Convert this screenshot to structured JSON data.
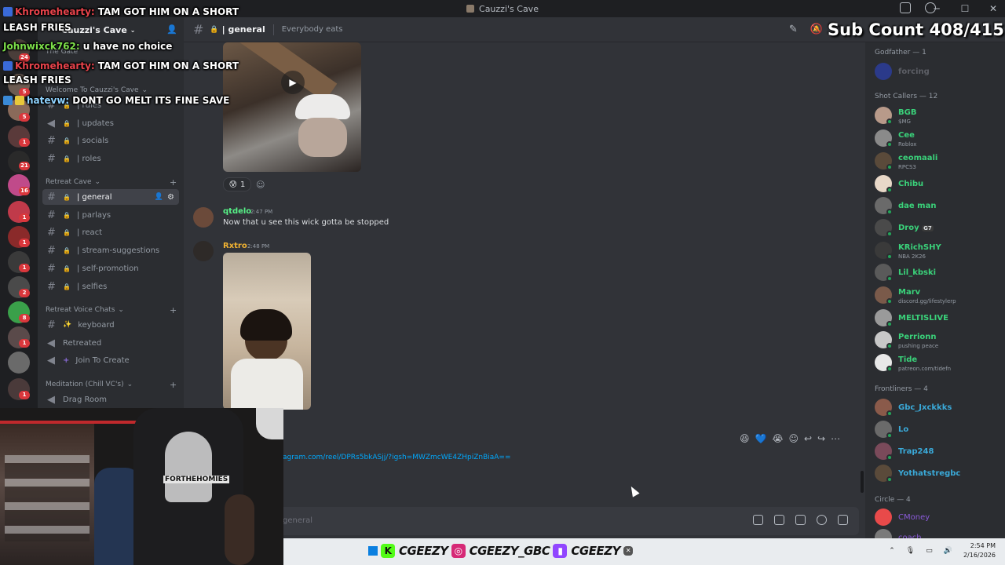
{
  "window": {
    "title": "Cauzzi's Cave"
  },
  "server": {
    "name": "Cauzzi's Cave"
  },
  "sidebar": {
    "categories": {
      "the_gate": "The Gate",
      "welcome": "Welcome To Cauzzi's Cave",
      "retreat_cave": "Retreat Cave",
      "retreat_voice": "Retreat Voice Chats",
      "meditation": "Meditation (Chill VC's)"
    },
    "welcome_channels": [
      "| rules",
      "| updates",
      "| socials",
      "| roles"
    ],
    "retreat_channels": [
      "| general",
      "| parlays",
      "| react",
      "| stream-suggestions",
      "| self-promotion",
      "| selfies"
    ],
    "voice_channels": [
      "keyboard",
      "Retreated",
      "Join To Create"
    ],
    "meditation_channels": [
      "Drag Room"
    ],
    "rail_badges": [
      "24",
      "5",
      "5",
      "1",
      "21",
      "16",
      "1",
      "1",
      "1",
      "2",
      "8",
      "1",
      "1"
    ]
  },
  "channel_header": {
    "name": "| general",
    "topic": "Everybody eats"
  },
  "messages": [
    {
      "reaction_count": "1"
    },
    {
      "author": "qtdelo",
      "time": "2:47 PM",
      "text": "Now that u see this wick gotta be stopped",
      "color": "#57f287"
    },
    {
      "author": "Rxtro",
      "time": "2:48 PM",
      "color": "#f0b232"
    }
  ],
  "composer": {
    "link": "agram.com/reel/DPRs5bkASjj/?igsh=MWZmcWE4ZHpiZnBiaA==",
    "placeholder": "general"
  },
  "members": {
    "godfather_header": "Godfather — 1",
    "godfather": [
      {
        "name": "forcing",
        "sub": ""
      }
    ],
    "shotcallers_header": "Shot Callers — 12",
    "shotcallers": [
      {
        "name": "BGB",
        "sub": "$MG"
      },
      {
        "name": "Cee",
        "sub": "Roblox"
      },
      {
        "name": "ceomaali",
        "sub": "RPCS3"
      },
      {
        "name": "Chibu",
        "sub": ""
      },
      {
        "name": "dae man",
        "sub": ""
      },
      {
        "name": "Droy",
        "sub": ""
      },
      {
        "name": "KRichSHY",
        "sub": "NBA 2K26"
      },
      {
        "name": "Lil_kbski",
        "sub": ""
      },
      {
        "name": "Marv",
        "sub": "discord.gg/lifestylerp"
      },
      {
        "name": "MELTISLIVE",
        "sub": ""
      },
      {
        "name": "Perrionn",
        "sub": "pushing peace"
      },
      {
        "name": "Tide",
        "sub": "patreon.com/tidefn"
      }
    ],
    "frontliners_header": "Frontliners — 4",
    "frontliners": [
      {
        "name": "Gbc_Jxckkks"
      },
      {
        "name": "Lo"
      },
      {
        "name": "Trap248"
      },
      {
        "name": "Yothatstregbc"
      }
    ],
    "circle_header": "Circle — 4",
    "circle": [
      {
        "name": "CMoney"
      },
      {
        "name": "coach"
      }
    ],
    "tags": {
      "droy": "G7"
    }
  },
  "overlay": {
    "chat": [
      {
        "user": "Khromehearty:",
        "text": "TAM GOT HIM ON A SHORT",
        "text2": "LEASH FRIES",
        "color": "#e8434b"
      },
      {
        "user": "Johnwixck762:",
        "text": "u have no choice",
        "color": "#7de04a"
      },
      {
        "user": "Khromehearty:",
        "text": "TAM GOT HIM ON A SHORT",
        "text2": "LEASH FRIES",
        "color": "#e8434b"
      },
      {
        "user": "hatevw:",
        "text": "DONT GO MELT ITS FINE SAVE",
        "color": "#8fd3ff"
      }
    ],
    "sub_count": "Sub Count 408/415",
    "shirt_text": "FORTHEHOMIES"
  },
  "taskbar": {
    "handles": [
      "CGEEZY",
      "CGEEZY_GBC",
      "CGEEZY"
    ],
    "time": "2:54 PM",
    "date": "2/16/2026"
  },
  "colors": {
    "accent": "#5865f2",
    "link": "#00a8fc",
    "online": "#23a55a"
  }
}
